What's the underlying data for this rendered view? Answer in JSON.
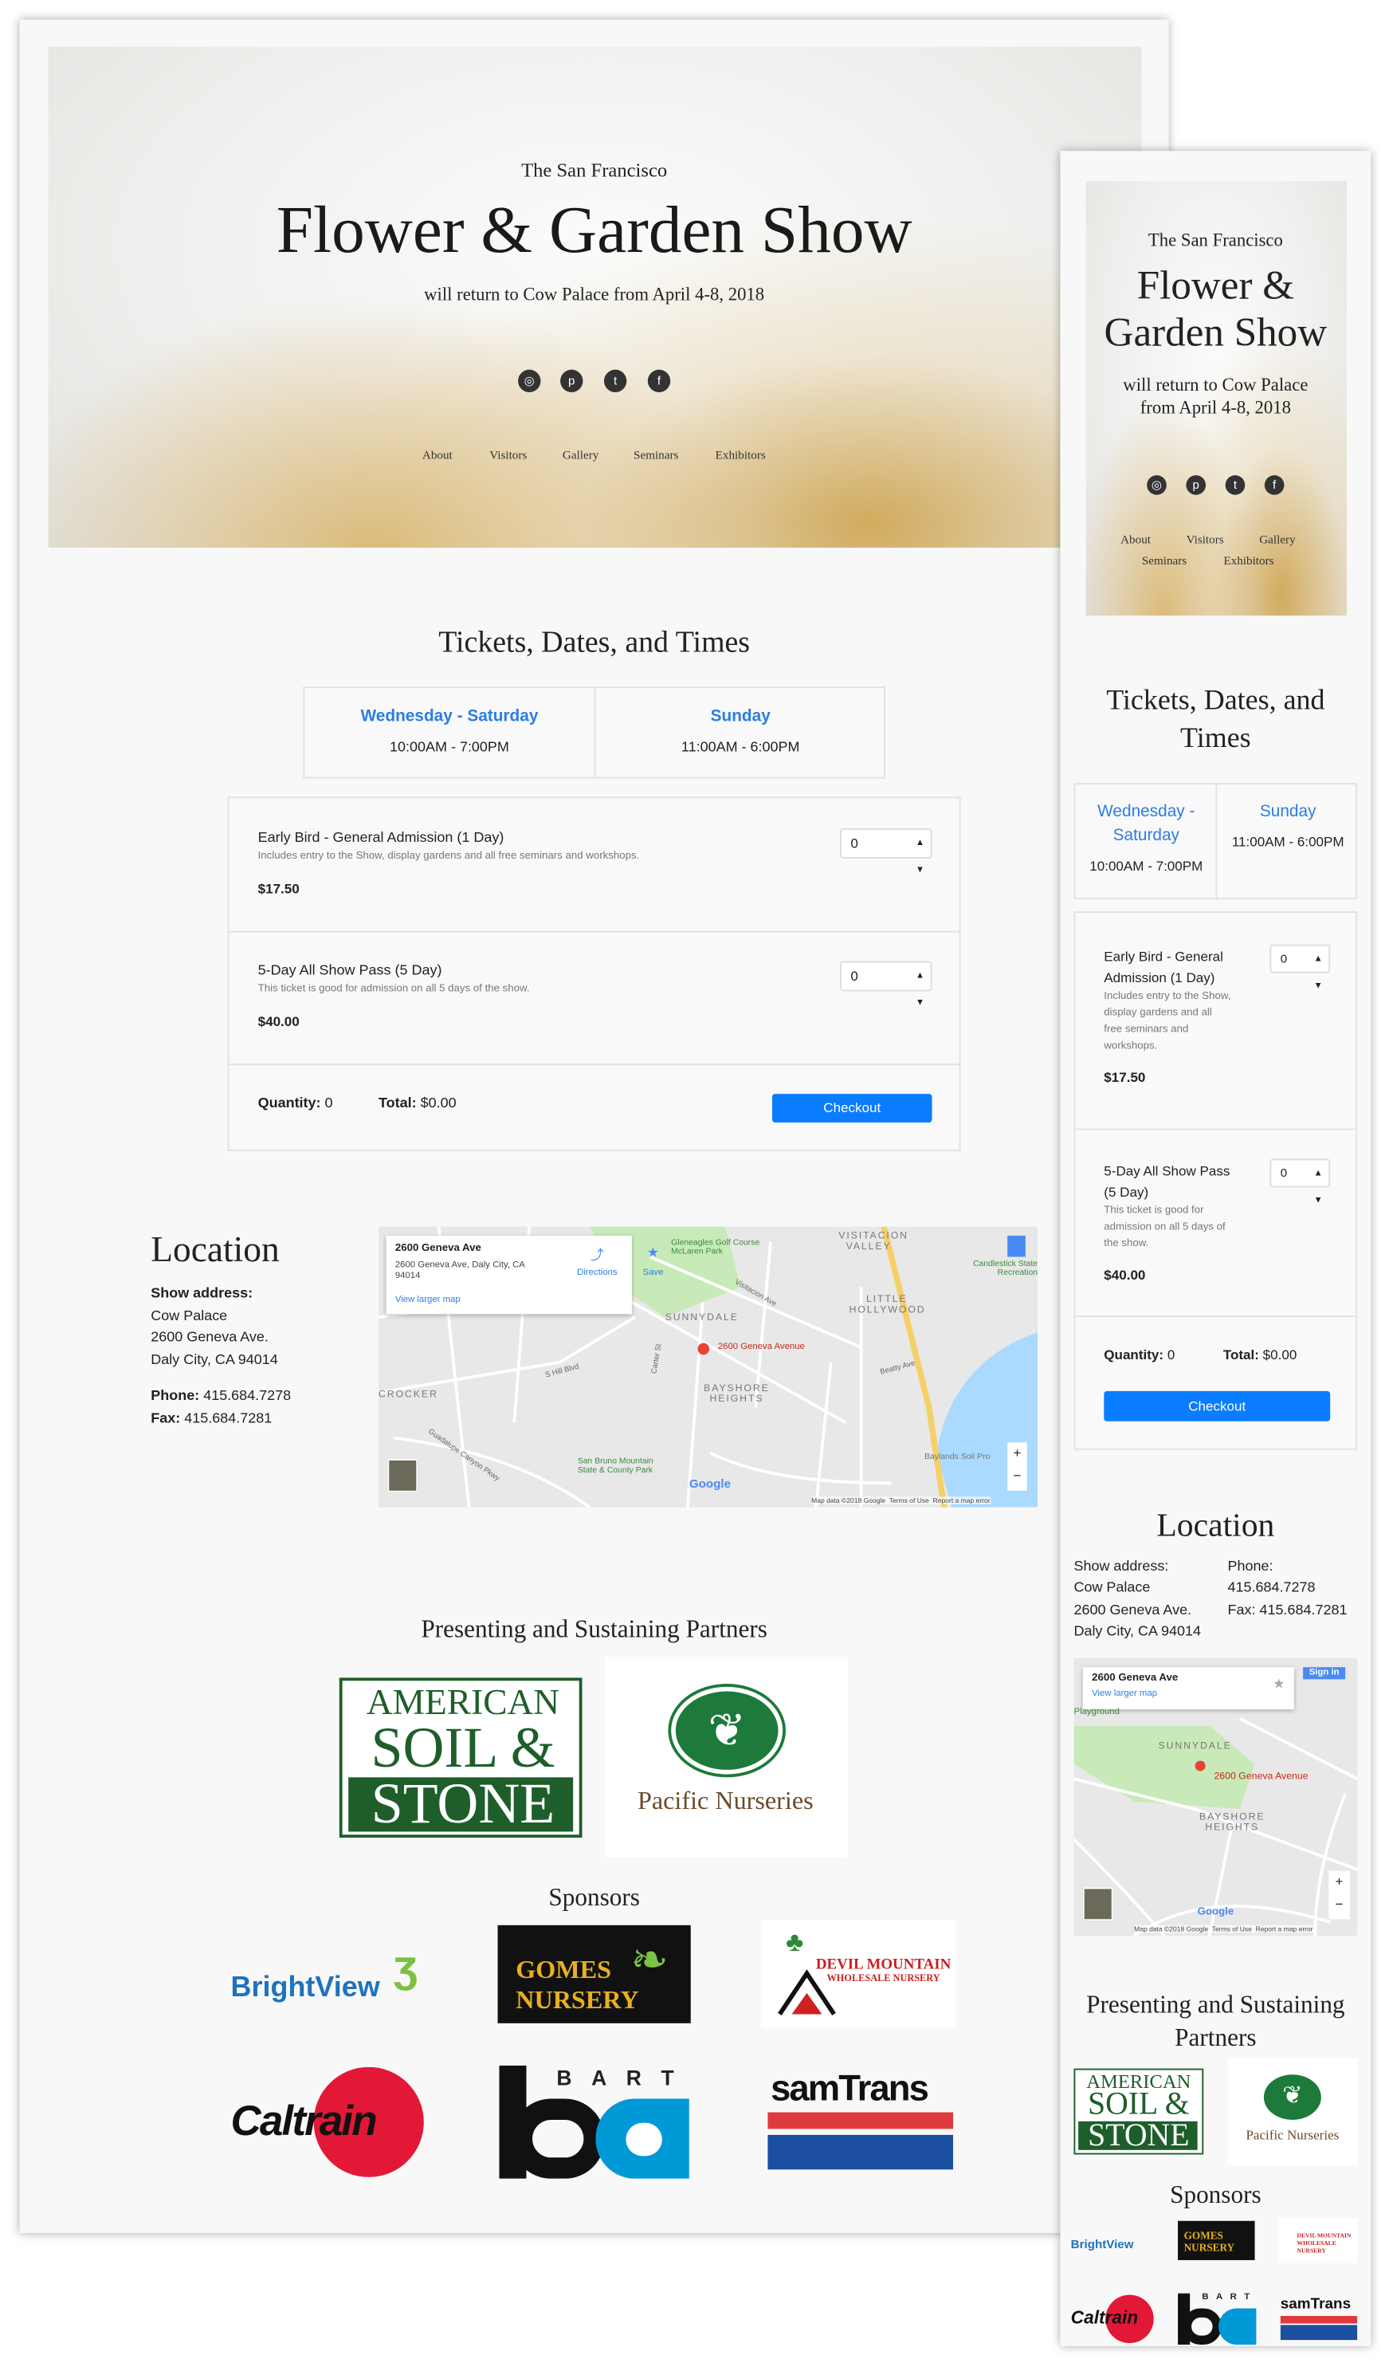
{
  "hero": {
    "pretitle": "The San Francisco",
    "title": "Flower & Garden Show",
    "title_line1": "Flower &",
    "title_line2": "Garden Show",
    "subtitle": "will return to Cow Palace from April 4-8, 2018",
    "subtitle_line1": "will return to Cow Palace",
    "subtitle_line2": "from April 4-8, 2018",
    "social": [
      {
        "icon": "instagram-icon",
        "glyph": "◎"
      },
      {
        "icon": "pinterest-icon",
        "glyph": "p"
      },
      {
        "icon": "twitter-icon",
        "glyph": "t"
      },
      {
        "icon": "facebook-icon",
        "glyph": "f"
      }
    ],
    "nav": [
      "About",
      "Visitors",
      "Gallery",
      "Seminars",
      "Exhibitors"
    ]
  },
  "tickets": {
    "heading": "Tickets, Dates, and Times",
    "heading_line1": "Tickets, Dates, and",
    "heading_line2": "Times",
    "dates": [
      {
        "days": "Wednesday - Saturday",
        "days_line1": "Wednesday -",
        "days_line2": "Saturday",
        "hours": "10:00AM - 7:00PM"
      },
      {
        "days": "Sunday",
        "hours": "11:00AM - 6:00PM"
      }
    ],
    "items": [
      {
        "name": "Early Bird - General Admission (1 Day)",
        "name_line1": "Early Bird - General",
        "name_line2": "Admission (1 Day)",
        "desc": "Includes entry to the Show, display gardens and all free seminars and workshops.",
        "desc_lines": [
          "Includes entry to the Show,",
          "display gardens and all",
          "free seminars and",
          "workshops."
        ],
        "price": "$17.50",
        "qty": "0"
      },
      {
        "name": "5-Day All Show Pass (5 Day)",
        "name_line1": "5-Day All Show Pass",
        "name_line2": "(5 Day)",
        "desc": "This ticket is good for admission on all 5 days of the show.",
        "desc_lines": [
          "This ticket is good for",
          "admission on all 5 days of",
          "the show."
        ],
        "price": "$40.00",
        "qty": "0"
      }
    ],
    "quantity_label": "Quantity:",
    "quantity": "0",
    "total_label": "Total:",
    "total": "$0.00",
    "checkout": "Checkout"
  },
  "location": {
    "heading": "Location",
    "address_label": "Show address:",
    "address": [
      "Cow Palace",
      "2600 Geneva Ave.",
      "Daly City, CA 94014"
    ],
    "phone_label": "Phone:",
    "phone": "415.684.7278",
    "fax_label": "Fax:",
    "fax": "415.684.7281"
  },
  "map": {
    "place": "2600 Geneva Ave",
    "place_address": "2600 Geneva Ave, Daly City, CA 94014",
    "directions": "Directions",
    "save": "Save",
    "view_larger": "View larger map",
    "sign_in": "Sign in",
    "pin_label": "2600 Geneva Avenue",
    "labels": {
      "visitacion": "VISITACION VALLEY",
      "golf": "Gleneagles Golf Course McLaren Park",
      "candlestick": "Candlestick State Recreation",
      "little": "LITTLE HOLLYWOOD",
      "sunnydale": "SUNNYDALE",
      "bayshore": "BAYSHORE HEIGHTS",
      "crocker": "CROCKER",
      "sanbruno": "San Bruno Mountain State & County Park",
      "baylands": "Baylands Soil Pro",
      "shill": "S Hill Blvd",
      "carter": "Carter St",
      "guadalupe": "Guadalupe Canyon Pkwy",
      "visave": "Visitacion Ave",
      "beatty": "Beatty Ave",
      "playground": "Playground"
    },
    "google": "Google",
    "map_data": "Map data ©2018 Google",
    "terms": "Terms of Use",
    "report": "Report a map error",
    "zoom_in": "+",
    "zoom_out": "−"
  },
  "partners": {
    "heading": "Presenting and Sustaining Partners",
    "heading_line1": "Presenting and Sustaining",
    "heading_line2": "Partners",
    "american": [
      "AMERICAN",
      "SOIL &",
      "STONE"
    ],
    "pacific": "Pacific Nurseries"
  },
  "sponsors": {
    "heading": "Sponsors",
    "brightview": "BrightView",
    "gomes": [
      "GOMES",
      "NURSERY"
    ],
    "devil": [
      "DEVIL MOUNTAIN",
      "WHOLESALE NURSERY"
    ],
    "caltrain": "Caltrain",
    "bart": "BART",
    "samtrans": "samTrans"
  },
  "colors": {
    "accent": "#0a7cff",
    "link": "#2a7ee0",
    "pin": "#ea4335",
    "soil_green": "#1e5e2a"
  }
}
